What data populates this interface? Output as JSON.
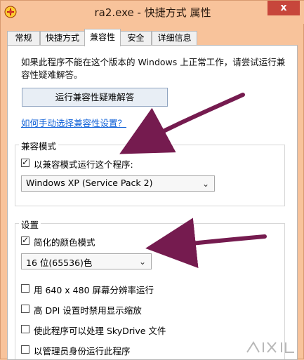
{
  "window": {
    "title": "ra2.exe - 快捷方式 属性",
    "close_label": "x"
  },
  "tabs": [
    {
      "label": "常规",
      "active": false
    },
    {
      "label": "快捷方式",
      "active": false
    },
    {
      "label": "兼容性",
      "active": true
    },
    {
      "label": "安全",
      "active": false
    },
    {
      "label": "详细信息",
      "active": false
    }
  ],
  "intro": {
    "text": "如果此程序不能在这个版本的 Windows 上正常工作，请尝试运行兼容性疑难解答。"
  },
  "buttons": {
    "run_troubleshooter": "运行兼容性疑难解答"
  },
  "links": {
    "manual_selection": "如何手动选择兼容性设置？"
  },
  "compatibility_mode": {
    "group_label": "兼容模式",
    "checkbox_label": "以兼容模式运行这个程序:",
    "checked": true,
    "selected_os": "Windows XP (Service Pack 2)"
  },
  "settings": {
    "group_label": "设置",
    "reduced_color": {
      "label": "简化的颜色模式",
      "checked": true
    },
    "color_mode_value": "16 位(65536)色",
    "options": [
      {
        "label": "用 640 x 480 屏幕分辨率运行",
        "checked": false
      },
      {
        "label": "高 DPI 设置时禁用显示缩放",
        "checked": false
      },
      {
        "label": "使此程序可以处理 SkyDrive 文件",
        "checked": false
      },
      {
        "label": "以管理员身份运行此程序",
        "checked": false
      }
    ]
  },
  "colors": {
    "frame": "#f8c39b",
    "panel": "#ffffff",
    "close": "#c7463b",
    "arrow": "#751b4f",
    "link": "#0b5ed7"
  },
  "icons": {
    "app": "game-icon",
    "close": "close-icon",
    "dropdown": "chevron-down-icon",
    "annotation": "pointer-arrow-icon"
  }
}
